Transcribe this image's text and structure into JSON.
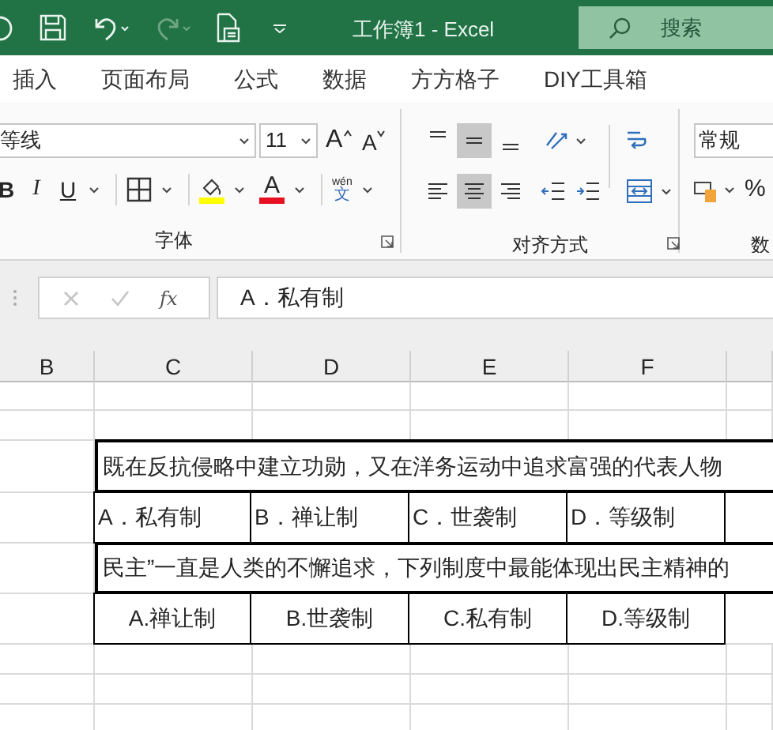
{
  "window": {
    "title": "工作簿1  -  Excel"
  },
  "search": {
    "placeholder": "搜索"
  },
  "quick_access": [
    {
      "kind": "save",
      "disabled": false
    },
    {
      "kind": "undo",
      "disabled": false
    },
    {
      "kind": "redo",
      "disabled": true
    },
    {
      "kind": "print_preview",
      "disabled": false
    }
  ],
  "tabs": [
    {
      "label": "插入"
    },
    {
      "label": "页面布局"
    },
    {
      "label": "公式"
    },
    {
      "label": "数据"
    },
    {
      "label": "方方格子"
    },
    {
      "label": "DIY工具箱"
    }
  ],
  "ribbon": {
    "font_name": "等线",
    "font_size": "11",
    "grow_font": "A",
    "shrink_font": "A",
    "bold": "B",
    "italic": "I",
    "underline": "U",
    "font_color": "A",
    "phonetic_top": "wén",
    "phonetic_bottom": "文",
    "number_format": "常规",
    "percent": "%",
    "vertical_align": [
      {
        "selected": false
      },
      {
        "selected": true
      },
      {
        "selected": false
      }
    ],
    "horizontal_align": [
      {
        "selected": false
      },
      {
        "selected": true
      },
      {
        "selected": false
      }
    ],
    "groups": [
      "字体",
      "对齐方式",
      "数"
    ]
  },
  "formula_bar": {
    "buttons": [
      {
        "kind": "cancel",
        "disabled": true
      },
      {
        "kind": "enter",
        "disabled": true
      }
    ],
    "fx": "fx",
    "value": "A．私有制"
  },
  "sheet": {
    "columns": [
      "B",
      "C",
      "D",
      "E",
      "F"
    ],
    "rows": [
      {
        "kind": "empty"
      },
      {
        "kind": "empty"
      },
      {
        "kind": "question",
        "text": "既在反抗侵略中建立功勋，又在洋务运动中追求富强的代表人物"
      },
      {
        "kind": "options",
        "cells": [
          "A．私有制",
          "B．禅让制",
          "C．世袭制",
          "D．等级制"
        ]
      },
      {
        "kind": "question",
        "text": "民主”一直是人类的不懈追求，下列制度中最能体现出民主精神的"
      },
      {
        "kind": "options_centered",
        "cells": [
          "A.禅让制",
          "B.世袭制",
          "C.私有制",
          "D.等级制"
        ]
      },
      {
        "kind": "empty"
      },
      {
        "kind": "empty"
      },
      {
        "kind": "empty"
      }
    ]
  }
}
